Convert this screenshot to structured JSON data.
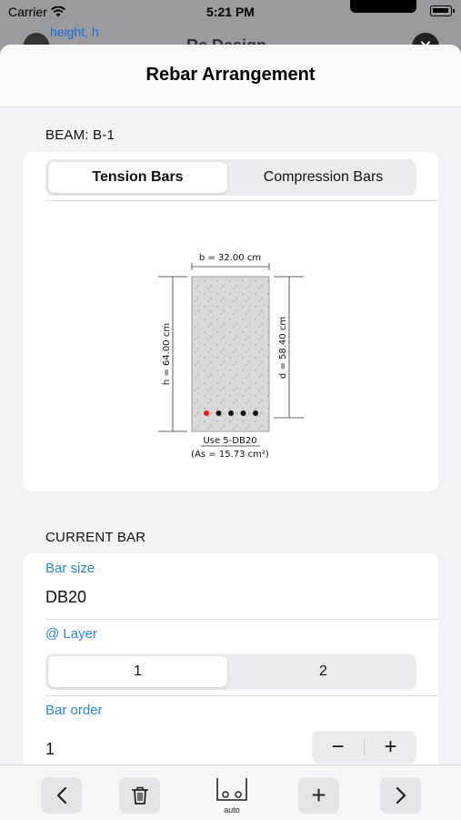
{
  "status_bar": {
    "carrier": "Carrier",
    "time": "5:21 PM"
  },
  "background_screen": {
    "hint_label": "height, h",
    "title": "Rc Design",
    "close_glyph": "✕"
  },
  "sheet": {
    "title": "Rebar Arrangement"
  },
  "beam_section": {
    "label": "BEAM: B-1",
    "tabs": [
      {
        "label": "Tension Bars",
        "selected": true
      },
      {
        "label": "Compression Bars",
        "selected": false
      }
    ],
    "diagram": {
      "width_label": "b = 32.00 cm",
      "height_label": "h = 64.00 cm",
      "depth_label": "d = 58.40 cm",
      "use_label": "Use 5-DB20",
      "area_label": "(As = 15.73 cm²)",
      "bars_count": 5,
      "highlight_bar_index": 1,
      "highlight_color": "#e02020",
      "bar_color": "#111111"
    }
  },
  "current_bar": {
    "section_label": "CURRENT BAR",
    "bar_size": {
      "label": "Bar size",
      "value": "DB20"
    },
    "layer": {
      "label": "@ Layer",
      "options": [
        {
          "label": "1",
          "selected": true
        },
        {
          "label": "2",
          "selected": false
        }
      ]
    },
    "bar_order": {
      "label": "Bar order",
      "value": "1",
      "minus": "−",
      "plus": "+"
    }
  },
  "toolbar": {
    "prev_icon": "chevron-left-icon",
    "delete_icon": "trash-icon",
    "auto_label": "auto",
    "add_glyph": "+",
    "next_icon": "chevron-right-icon"
  },
  "colors": {
    "accent": "#2a86d8",
    "sheet_bg": "#f2f2f7",
    "card_bg": "#ffffff"
  }
}
